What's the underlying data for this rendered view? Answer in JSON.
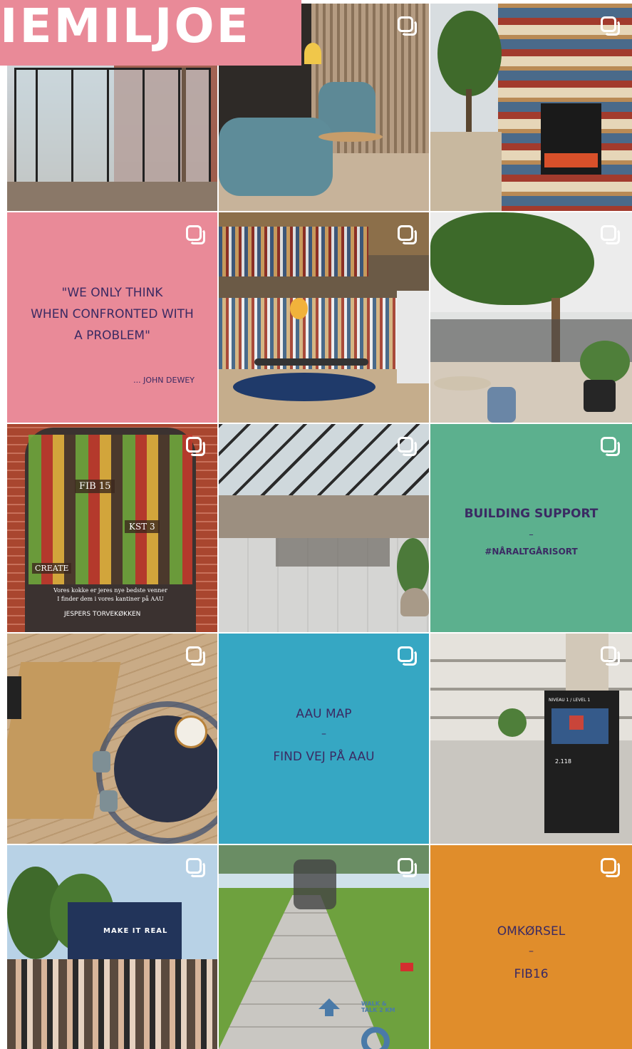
{
  "header": {
    "title": "IEMILJOE",
    "color": "#e98a98"
  },
  "tiles": [
    {
      "kind": "photo",
      "alt": "glass greenhouse"
    },
    {
      "kind": "photo",
      "alt": "blue lounge chair"
    },
    {
      "kind": "photo",
      "alt": "library shelves with tree"
    },
    {
      "kind": "text",
      "bg": "#e98a98",
      "lines": [
        "\"WE ONLY THINK",
        "WHEN CONFRONTED WITH",
        "A PROBLEM\""
      ],
      "author": "... JOHN DEWEY"
    },
    {
      "kind": "photo",
      "alt": "library reading room"
    },
    {
      "kind": "photo",
      "alt": "atrium with trees"
    },
    {
      "kind": "photo",
      "alt": "food poster column"
    },
    {
      "kind": "photo",
      "alt": "hall with skylight"
    },
    {
      "kind": "text",
      "bg": "#5cb08e",
      "title": "BUILDING SUPPORT",
      "dash": "–",
      "sub": "#NÅRALTGÅRISORT"
    },
    {
      "kind": "photo",
      "alt": "meeting room top view"
    },
    {
      "kind": "text",
      "bg": "#36a7c3",
      "title": "AAU MAP",
      "dash": "–",
      "sub": "FIND VEJ PÅ AAU"
    },
    {
      "kind": "photo",
      "alt": "atrium with level sign"
    },
    {
      "kind": "photo",
      "alt": "outdoor stage event"
    },
    {
      "kind": "photo",
      "alt": "path walk and talk"
    },
    {
      "kind": "text",
      "bg": "#e08d2b",
      "title": "OMKØRSEL",
      "dash": "–",
      "sub": "FIB16"
    }
  ],
  "poster": {
    "lines": [
      "FIB 15",
      "KST 3",
      "CREATE",
      "Vores kokke er jeres nye bedste venner",
      "I finder dem i vores kantiner på AAU",
      "JESPERS TORVEKØKKEN"
    ]
  },
  "stage": {
    "banner": "MAKE IT REAL"
  },
  "path": {
    "stencil": "WALK & TALK 2 KM"
  },
  "sign": {
    "level": "NIVEAU 1 / LEVEL 1",
    "room": "2.118"
  },
  "colors": {
    "pink": "#e98a98",
    "green": "#5cb08e",
    "blue": "#36a7c3",
    "orange": "#e08d2b",
    "navy": "#3b2a63"
  }
}
